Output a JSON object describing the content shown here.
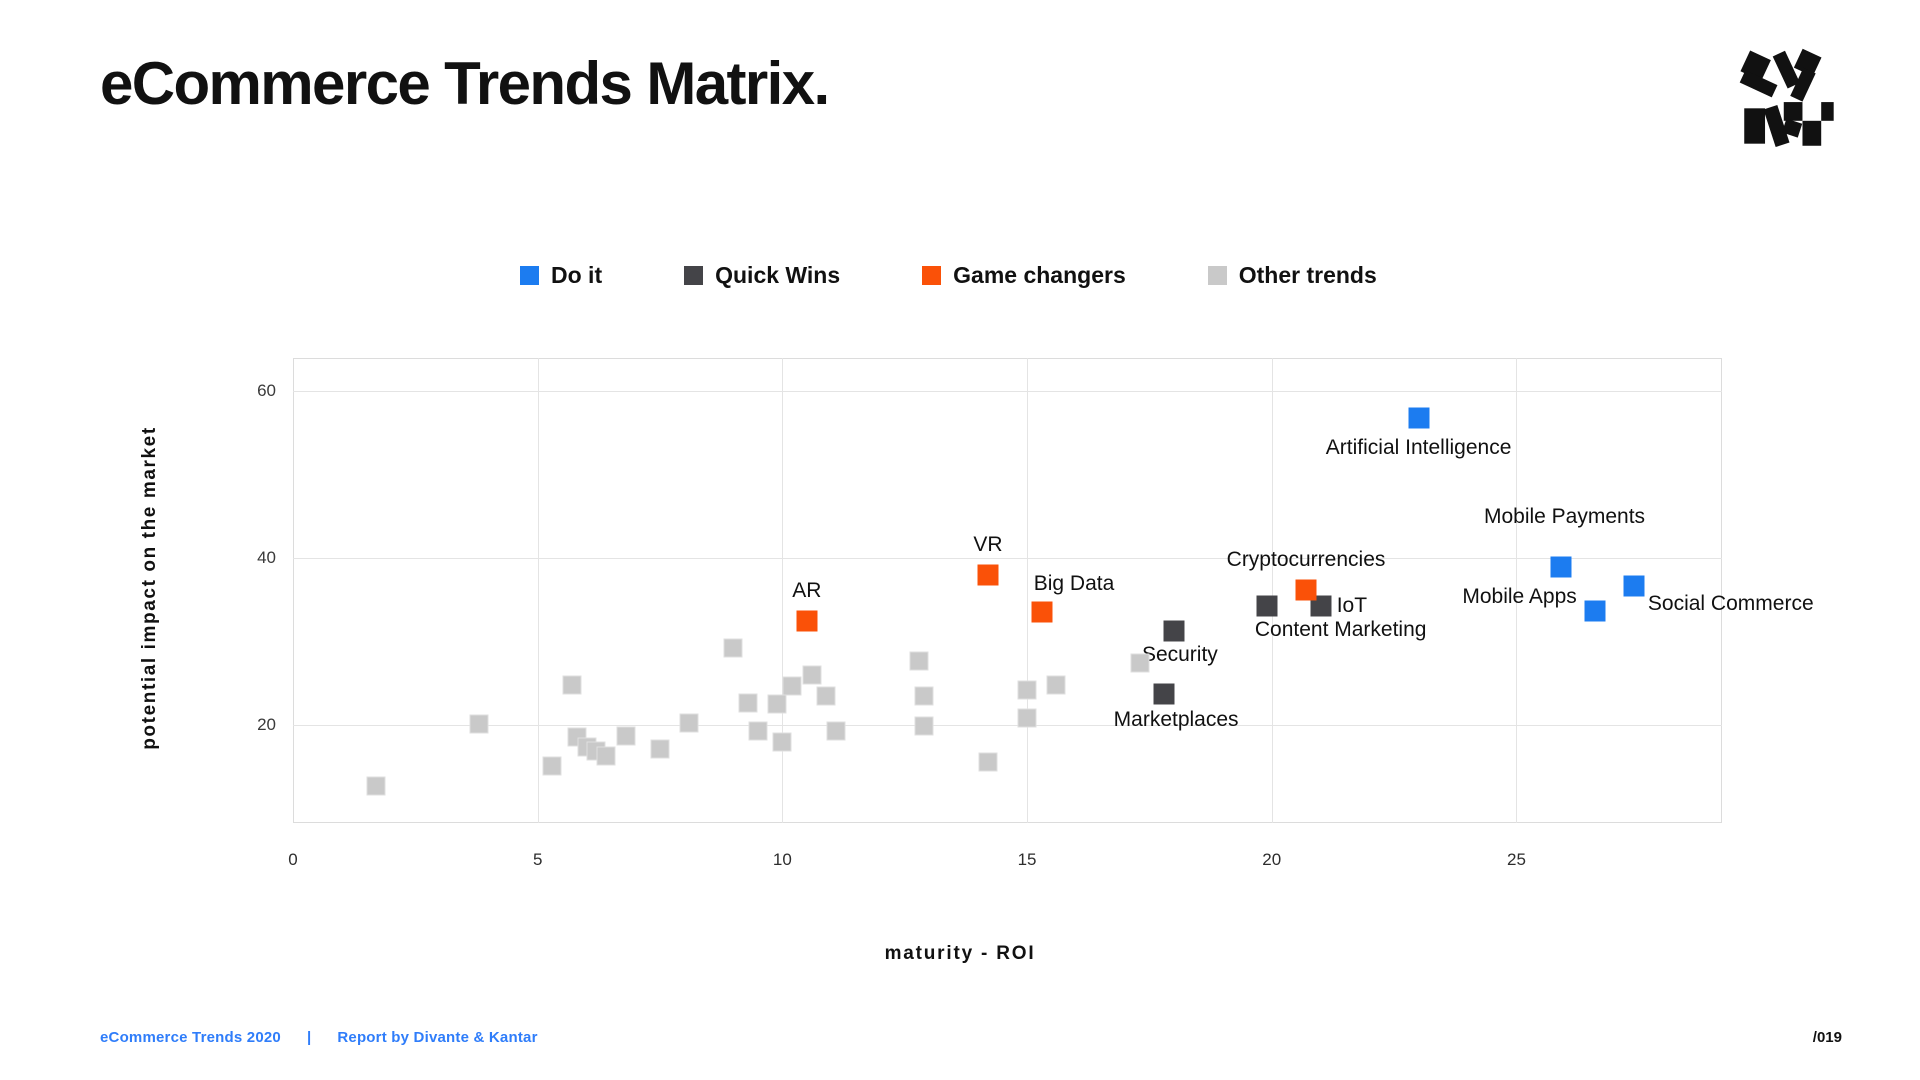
{
  "header": {
    "title": "eCommerce Trends Matrix.",
    "logo_name": "divante-logo"
  },
  "footer": {
    "left_text": "eCommerce Trends 2020",
    "separator": "|",
    "right_text": "Report by Divante & Kantar",
    "page_number": "/019"
  },
  "colors": {
    "do_it": "#1C7CF0",
    "quick_wins": "#444448",
    "game_changers": "#FA5108",
    "other_trends": "#C9C9C9",
    "footer_blue": "#2F7DFA",
    "grid": "#E4E4E4",
    "text": "#111111"
  },
  "legend": {
    "items": [
      {
        "label": "Do it",
        "key": "do_it",
        "color": "#1C7CF0"
      },
      {
        "label": "Quick Wins",
        "key": "quick_wins",
        "color": "#444448"
      },
      {
        "label": "Game changers",
        "key": "game_changers",
        "color": "#FA5108"
      },
      {
        "label": "Other trends",
        "key": "other_trends",
        "color": "#C9C9C9"
      }
    ]
  },
  "chart_data": {
    "type": "scatter",
    "title": "eCommerce Trends Matrix.",
    "xlabel": "maturity - ROI",
    "ylabel": "potential impact on the market",
    "xlim": [
      0,
      29.2
    ],
    "ylim": [
      8.2,
      64.0
    ],
    "xticks": [
      0,
      5,
      10,
      15,
      20,
      25
    ],
    "yticks": [
      20,
      40,
      60
    ],
    "grid": true,
    "legend_position": "top-center",
    "series": [
      {
        "name": "Do it",
        "color": "#1C7CF0",
        "marker": "square",
        "points": [
          {
            "label": "Artificial Intelligence",
            "x": 23.0,
            "y": 56.8,
            "label_pos": "center",
            "label_dx": 0,
            "label_dy": 18
          },
          {
            "label": "Mobile Payments",
            "x": 25.9,
            "y": 38.9,
            "label_pos": "center",
            "label_dx": 4,
            "label_dy": -62
          },
          {
            "label": "Mobile Apps",
            "x": 26.6,
            "y": 33.7,
            "label_pos": "right",
            "label_dx": -18,
            "label_dy": -26
          },
          {
            "label": "Social Commerce",
            "x": 27.4,
            "y": 36.6,
            "label_pos": "left",
            "label_dx": 14,
            "label_dy": 6
          }
        ]
      },
      {
        "name": "Quick Wins",
        "color": "#444448",
        "marker": "square",
        "points": [
          {
            "label": "Security",
            "x": 18.0,
            "y": 31.3,
            "label_pos": "center",
            "label_dx": 6,
            "label_dy": 12
          },
          {
            "label": "Marketplaces",
            "x": 17.8,
            "y": 23.7,
            "label_pos": "center",
            "label_dx": 12,
            "label_dy": 14
          },
          {
            "label": "IoT",
            "x": 21.0,
            "y": 34.2,
            "label_pos": "left",
            "label_dx": 16,
            "label_dy": -12
          },
          {
            "label": "Content Marketing",
            "x": 19.9,
            "y": 34.2,
            "label_pos": "left",
            "label_dx": -12,
            "label_dy": 12
          }
        ]
      },
      {
        "name": "Game changers",
        "color": "#FA5108",
        "marker": "square",
        "points": [
          {
            "label": "AR",
            "x": 10.5,
            "y": 32.4,
            "label_pos": "center",
            "label_dx": 0,
            "label_dy": -42
          },
          {
            "label": "VR",
            "x": 14.2,
            "y": 38.0,
            "label_pos": "center",
            "label_dx": 0,
            "label_dy": -42
          },
          {
            "label": "Big Data",
            "x": 15.3,
            "y": 33.5,
            "label_pos": "left",
            "label_dx": -8,
            "label_dy": -40
          },
          {
            "label": "Cryptocurrencies",
            "x": 20.7,
            "y": 36.2,
            "label_pos": "center",
            "label_dx": 0,
            "label_dy": -42
          }
        ]
      },
      {
        "name": "Other trends",
        "color": "#C9C9C9",
        "marker": "square",
        "points": [
          {
            "label": "",
            "x": 1.7,
            "y": 12.6
          },
          {
            "label": "",
            "x": 3.8,
            "y": 20.1
          },
          {
            "label": "",
            "x": 5.3,
            "y": 15.0
          },
          {
            "label": "",
            "x": 5.7,
            "y": 24.8
          },
          {
            "label": "",
            "x": 5.8,
            "y": 18.5
          },
          {
            "label": "",
            "x": 6.0,
            "y": 17.3
          },
          {
            "label": "",
            "x": 6.2,
            "y": 16.8
          },
          {
            "label": "",
            "x": 6.4,
            "y": 16.2
          },
          {
            "label": "",
            "x": 6.8,
            "y": 18.6
          },
          {
            "label": "",
            "x": 7.5,
            "y": 17.1
          },
          {
            "label": "",
            "x": 8.1,
            "y": 20.2
          },
          {
            "label": "",
            "x": 9.0,
            "y": 29.2
          },
          {
            "label": "",
            "x": 9.3,
            "y": 22.6
          },
          {
            "label": "",
            "x": 9.5,
            "y": 19.2
          },
          {
            "label": "",
            "x": 9.9,
            "y": 22.5
          },
          {
            "label": "",
            "x": 10.0,
            "y": 17.9
          },
          {
            "label": "",
            "x": 10.2,
            "y": 24.7
          },
          {
            "label": "",
            "x": 10.6,
            "y": 26.0
          },
          {
            "label": "",
            "x": 10.9,
            "y": 23.4
          },
          {
            "label": "",
            "x": 11.1,
            "y": 19.2
          },
          {
            "label": "",
            "x": 12.8,
            "y": 27.6
          },
          {
            "label": "",
            "x": 12.9,
            "y": 23.5
          },
          {
            "label": "",
            "x": 12.9,
            "y": 19.8
          },
          {
            "label": "",
            "x": 14.2,
            "y": 15.5
          },
          {
            "label": "",
            "x": 15.0,
            "y": 24.2
          },
          {
            "label": "",
            "x": 15.0,
            "y": 20.8
          },
          {
            "label": "",
            "x": 15.6,
            "y": 24.8
          },
          {
            "label": "",
            "x": 17.3,
            "y": 27.4
          }
        ]
      }
    ]
  }
}
